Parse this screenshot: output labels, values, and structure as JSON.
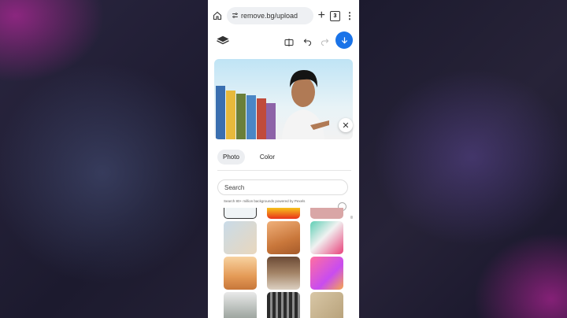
{
  "browser": {
    "home_icon": "home-icon",
    "site_icon": "tune-icon",
    "url": "remove.bg/upload",
    "new_tab_icon": "plus-icon",
    "tab_count": "3",
    "menu_icon": "kebab-icon"
  },
  "editor_toolbar": {
    "layers_icon": "layers-icon",
    "compare_icon": "compare-icon",
    "undo_icon": "undo-icon",
    "redo_icon": "redo-icon",
    "download_icon": "download-icon"
  },
  "background_panel": {
    "tabs": [
      {
        "label": "Photo",
        "active": true
      },
      {
        "label": "Color",
        "active": false
      }
    ],
    "search_placeholder": "Search",
    "credit_text": "Search 80+ million backgrounds powered by Pexels"
  },
  "colors": {
    "accent": "#1a73e8",
    "page_bg": "#1b1830",
    "glow": "#dc28b4"
  }
}
